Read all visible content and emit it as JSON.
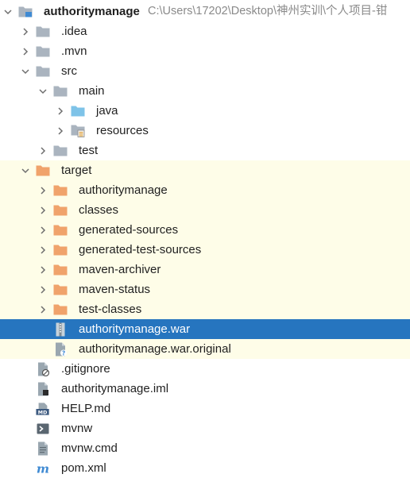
{
  "colors": {
    "folder_gray": "#aab4bf",
    "folder_orange": "#f0a36b",
    "folder_blue": "#7ec3e8",
    "excluded_bg": "#fefde8",
    "selected_bg": "#2675bf"
  },
  "tree": [
    {
      "id": "project-root",
      "label": "authoritymanage",
      "path": "C:\\Users\\17202\\Desktop\\神州实训\\个人项目-钳",
      "icon": "module-folder-icon",
      "depth": 0,
      "arrow": "down",
      "bold": true
    },
    {
      "id": "idea",
      "label": ".idea",
      "icon": "folder-gray-icon",
      "depth": 1,
      "arrow": "right"
    },
    {
      "id": "mvn",
      "label": ".mvn",
      "icon": "folder-gray-icon",
      "depth": 1,
      "arrow": "right"
    },
    {
      "id": "src",
      "label": "src",
      "icon": "folder-gray-icon",
      "depth": 1,
      "arrow": "down"
    },
    {
      "id": "main",
      "label": "main",
      "icon": "folder-gray-icon",
      "depth": 2,
      "arrow": "down"
    },
    {
      "id": "java",
      "label": "java",
      "icon": "folder-blue-icon",
      "depth": 3,
      "arrow": "right"
    },
    {
      "id": "resources",
      "label": "resources",
      "icon": "resources-folder-icon",
      "depth": 3,
      "arrow": "right"
    },
    {
      "id": "test",
      "label": "test",
      "icon": "folder-gray-icon",
      "depth": 2,
      "arrow": "right"
    },
    {
      "id": "target",
      "label": "target",
      "icon": "folder-orange-icon",
      "depth": 1,
      "arrow": "down",
      "excluded": true
    },
    {
      "id": "target-authoritymanage",
      "label": "authoritymanage",
      "icon": "folder-orange-icon",
      "depth": 2,
      "arrow": "right",
      "excluded": true
    },
    {
      "id": "classes",
      "label": "classes",
      "icon": "folder-orange-icon",
      "depth": 2,
      "arrow": "right",
      "excluded": true
    },
    {
      "id": "generated-sources",
      "label": "generated-sources",
      "icon": "folder-orange-icon",
      "depth": 2,
      "arrow": "right",
      "excluded": true
    },
    {
      "id": "generated-test-sources",
      "label": "generated-test-sources",
      "icon": "folder-orange-icon",
      "depth": 2,
      "arrow": "right",
      "excluded": true
    },
    {
      "id": "maven-archiver",
      "label": "maven-archiver",
      "icon": "folder-orange-icon",
      "depth": 2,
      "arrow": "right",
      "excluded": true
    },
    {
      "id": "maven-status",
      "label": "maven-status",
      "icon": "folder-orange-icon",
      "depth": 2,
      "arrow": "right",
      "excluded": true
    },
    {
      "id": "test-classes",
      "label": "test-classes",
      "icon": "folder-orange-icon",
      "depth": 2,
      "arrow": "right",
      "excluded": true
    },
    {
      "id": "war",
      "label": "authoritymanage.war",
      "icon": "archive-file-icon",
      "depth": 2,
      "arrow": "none",
      "selected": true
    },
    {
      "id": "war-original",
      "label": "authoritymanage.war.original",
      "icon": "unknown-file-icon",
      "depth": 2,
      "arrow": "none",
      "excluded": true
    },
    {
      "id": "gitignore",
      "label": ".gitignore",
      "icon": "ignore-file-icon",
      "depth": 1,
      "arrow": "none"
    },
    {
      "id": "iml",
      "label": "authoritymanage.iml",
      "icon": "iml-file-icon",
      "depth": 1,
      "arrow": "none"
    },
    {
      "id": "help-md",
      "label": "HELP.md",
      "icon": "markdown-file-icon",
      "depth": 1,
      "arrow": "none"
    },
    {
      "id": "mvnw",
      "label": "mvnw",
      "icon": "shell-script-icon",
      "depth": 1,
      "arrow": "none"
    },
    {
      "id": "mvnw-cmd",
      "label": "mvnw.cmd",
      "icon": "text-file-icon",
      "depth": 1,
      "arrow": "none"
    },
    {
      "id": "pom",
      "label": "pom.xml",
      "icon": "maven-pom-icon",
      "depth": 1,
      "arrow": "none"
    }
  ]
}
